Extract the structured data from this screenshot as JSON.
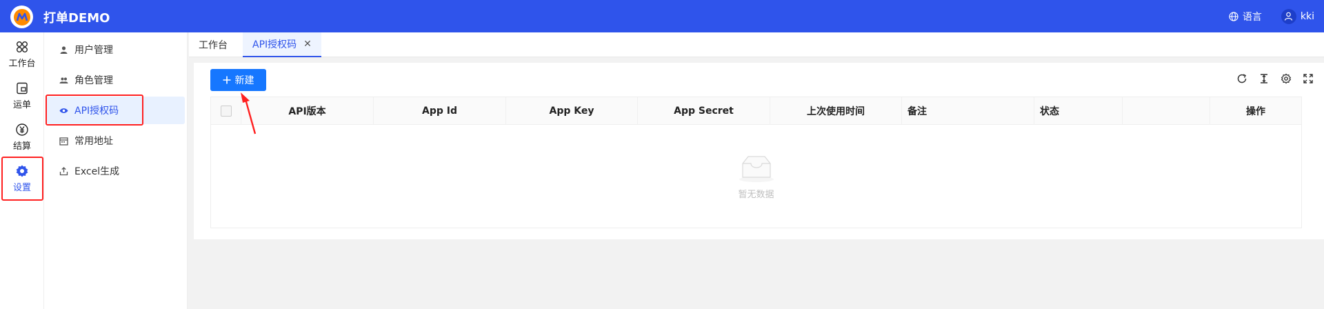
{
  "header": {
    "app_title": "打单DEMO",
    "language_label": "语言",
    "user_name": "kki",
    "brand_color": "#2f54eb"
  },
  "rail": {
    "items": [
      {
        "label": "工作台",
        "icon": "workbench-icon"
      },
      {
        "label": "运单",
        "icon": "waybill-icon"
      },
      {
        "label": "结算",
        "icon": "settlement-icon"
      },
      {
        "label": "设置",
        "icon": "settings-gear-icon",
        "active": true
      }
    ]
  },
  "submenu": {
    "items": [
      {
        "label": "用户管理",
        "icon": "user-icon"
      },
      {
        "label": "角色管理",
        "icon": "team-icon"
      },
      {
        "label": "API授权码",
        "icon": "eye-icon",
        "active": true
      },
      {
        "label": "常用地址",
        "icon": "calendar-icon"
      },
      {
        "label": "Excel生成",
        "icon": "export-icon"
      }
    ]
  },
  "tabs": [
    {
      "label": "工作台"
    },
    {
      "label": "API授权码",
      "active": true
    }
  ],
  "toolbar": {
    "new_button_label": "新建"
  },
  "table": {
    "columns": [
      "API版本",
      "App Id",
      "App Key",
      "App Secret",
      "上次使用时间",
      "备注",
      "状态",
      "",
      "操作"
    ],
    "empty_text": "暂无数据"
  },
  "colors": {
    "accent": "#1677ff",
    "highlight": "#ff1f1f"
  }
}
